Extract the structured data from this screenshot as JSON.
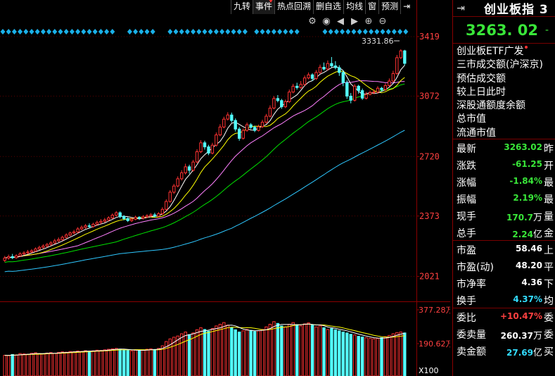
{
  "toolbar": {
    "items": [
      "九转",
      "事件",
      "热点回溯",
      "删自选",
      "均线",
      "窗",
      "预测"
    ],
    "close_glyph": "⇥"
  },
  "chart_data": {
    "type": "candlestick",
    "y_axis_ticks": [
      "3419",
      "3072",
      "2720",
      "2373",
      "2021"
    ],
    "y_tick_values": [
      3419,
      3072,
      2720,
      2373,
      2021
    ],
    "ylim": [
      1900,
      3460
    ],
    "high_marker": "3331.86",
    "volume_ticks": [
      "377.28万",
      "190.62万"
    ],
    "volume_unit": "X100",
    "candles": [
      [
        2115,
        2128,
        2140,
        2105
      ],
      [
        2128,
        2136,
        2148,
        2118
      ],
      [
        2136,
        2130,
        2152,
        2122
      ],
      [
        2130,
        2141,
        2150,
        2124
      ],
      [
        2141,
        2152,
        2162,
        2135
      ],
      [
        2152,
        2158,
        2168,
        2144
      ],
      [
        2158,
        2163,
        2175,
        2150
      ],
      [
        2163,
        2170,
        2180,
        2157
      ],
      [
        2170,
        2181,
        2190,
        2163
      ],
      [
        2181,
        2190,
        2200,
        2175
      ],
      [
        2190,
        2198,
        2208,
        2182
      ],
      [
        2198,
        2207,
        2216,
        2190
      ],
      [
        2207,
        2216,
        2226,
        2200
      ],
      [
        2216,
        2228,
        2240,
        2210
      ],
      [
        2228,
        2236,
        2248,
        2220
      ],
      [
        2236,
        2249,
        2258,
        2228
      ],
      [
        2249,
        2262,
        2272,
        2242
      ],
      [
        2262,
        2274,
        2282,
        2255
      ],
      [
        2274,
        2280,
        2292,
        2266
      ],
      [
        2280,
        2298,
        2308,
        2272
      ],
      [
        2298,
        2307,
        2318,
        2290
      ],
      [
        2307,
        2316,
        2326,
        2298
      ],
      [
        2316,
        2312,
        2330,
        2302
      ],
      [
        2312,
        2325,
        2334,
        2305
      ],
      [
        2325,
        2335,
        2346,
        2316
      ],
      [
        2335,
        2342,
        2355,
        2326
      ],
      [
        2342,
        2350,
        2362,
        2334
      ],
      [
        2350,
        2362,
        2372,
        2342
      ],
      [
        2362,
        2378,
        2388,
        2355
      ],
      [
        2378,
        2392,
        2402,
        2370
      ],
      [
        2392,
        2370,
        2400,
        2360
      ],
      [
        2370,
        2358,
        2378,
        2348
      ],
      [
        2358,
        2346,
        2366,
        2338
      ],
      [
        2346,
        2355,
        2364,
        2338
      ],
      [
        2355,
        2366,
        2375,
        2348
      ],
      [
        2366,
        2360,
        2372,
        2350
      ],
      [
        2360,
        2368,
        2378,
        2352
      ],
      [
        2368,
        2374,
        2384,
        2360
      ],
      [
        2374,
        2380,
        2390,
        2366
      ],
      [
        2380,
        2372,
        2392,
        2364
      ],
      [
        2372,
        2386,
        2396,
        2365
      ],
      [
        2386,
        2412,
        2424,
        2380
      ],
      [
        2412,
        2458,
        2470,
        2405
      ],
      [
        2458,
        2512,
        2524,
        2450
      ],
      [
        2512,
        2548,
        2560,
        2502
      ],
      [
        2548,
        2590,
        2604,
        2540
      ],
      [
        2590,
        2625,
        2640,
        2580
      ],
      [
        2625,
        2660,
        2678,
        2615
      ],
      [
        2660,
        2640,
        2672,
        2620
      ],
      [
        2640,
        2688,
        2700,
        2632
      ],
      [
        2688,
        2748,
        2762,
        2680
      ],
      [
        2748,
        2800,
        2815,
        2740
      ],
      [
        2800,
        2776,
        2812,
        2760
      ],
      [
        2776,
        2740,
        2788,
        2728
      ],
      [
        2740,
        2786,
        2800,
        2732
      ],
      [
        2786,
        2846,
        2860,
        2778
      ],
      [
        2846,
        2892,
        2908,
        2838
      ],
      [
        2892,
        2938,
        2952,
        2884
      ],
      [
        2938,
        2962,
        2978,
        2930
      ],
      [
        2962,
        2930,
        2976,
        2918
      ],
      [
        2930,
        2880,
        2942,
        2866
      ],
      [
        2880,
        2826,
        2892,
        2812
      ],
      [
        2826,
        2872,
        2884,
        2818
      ],
      [
        2872,
        2905,
        2918,
        2864
      ],
      [
        2905,
        2890,
        2915,
        2880
      ],
      [
        2890,
        2872,
        2900,
        2862
      ],
      [
        2872,
        2894,
        2906,
        2866
      ],
      [
        2894,
        2920,
        2934,
        2886
      ],
      [
        2920,
        2955,
        2968,
        2912
      ],
      [
        2955,
        3002,
        3018,
        2948
      ],
      [
        3002,
        3058,
        3072,
        2995
      ],
      [
        3058,
        3046,
        3078,
        3036
      ],
      [
        3046,
        3010,
        3056,
        2998
      ],
      [
        3010,
        3040,
        3052,
        3002
      ],
      [
        3040,
        3096,
        3110,
        3032
      ],
      [
        3096,
        3130,
        3144,
        3088
      ],
      [
        3130,
        3122,
        3150,
        3110
      ],
      [
        3122,
        3140,
        3160,
        3114
      ],
      [
        3140,
        3178,
        3192,
        3132
      ],
      [
        3178,
        3196,
        3210,
        3170
      ],
      [
        3196,
        3175,
        3205,
        3160
      ],
      [
        3175,
        3210,
        3224,
        3166
      ],
      [
        3210,
        3240,
        3256,
        3202
      ],
      [
        3240,
        3230,
        3268,
        3222
      ],
      [
        3230,
        3262,
        3280,
        3220
      ],
      [
        3262,
        3248,
        3300,
        3240
      ],
      [
        3248,
        3238,
        3276,
        3228
      ],
      [
        3238,
        3210,
        3252,
        3190
      ],
      [
        3210,
        3150,
        3222,
        3130
      ],
      [
        3150,
        3072,
        3164,
        3056
      ],
      [
        3072,
        3048,
        3090,
        3030
      ],
      [
        3048,
        3130,
        3142,
        3040
      ],
      [
        3130,
        3104,
        3138,
        3086
      ],
      [
        3104,
        3060,
        3116,
        3050
      ],
      [
        3060,
        3082,
        3096,
        3052
      ],
      [
        3082,
        3092,
        3104,
        3076
      ],
      [
        3092,
        3096,
        3110,
        3084
      ],
      [
        3096,
        3118,
        3130,
        3088
      ],
      [
        3118,
        3110,
        3126,
        3100
      ],
      [
        3110,
        3134,
        3146,
        3102
      ],
      [
        3134,
        3160,
        3175,
        3126
      ],
      [
        3160,
        3204,
        3220,
        3152
      ],
      [
        3204,
        3296,
        3312,
        3196
      ],
      [
        3296,
        3336,
        3345,
        3288
      ],
      [
        3336,
        3263,
        3342,
        3250
      ]
    ],
    "volumes": [
      120,
      118,
      125,
      122,
      130,
      128,
      126,
      132,
      135,
      130,
      128,
      133,
      136,
      131,
      137,
      140,
      138,
      142,
      141,
      145,
      143,
      147,
      144,
      146,
      150,
      148,
      152,
      155,
      158,
      160,
      156,
      150,
      148,
      146,
      152,
      150,
      149,
      155,
      158,
      154,
      160,
      175,
      200,
      215,
      225,
      232,
      245,
      255,
      240,
      250,
      268,
      280,
      270,
      260,
      275,
      290,
      300,
      310,
      295,
      280,
      268,
      255,
      262,
      270,
      265,
      258,
      262,
      270,
      285,
      300,
      315,
      305,
      290,
      285,
      300,
      310,
      298,
      290,
      302,
      308,
      295,
      285,
      290,
      280,
      270,
      275,
      268,
      262,
      255,
      250,
      242,
      238,
      230,
      226,
      222,
      218,
      215,
      218,
      222,
      228,
      235,
      245,
      252,
      255,
      250
    ]
  },
  "right_panel": {
    "header_icon": "⇥",
    "title": "创业板指 3",
    "price": "3263. 02",
    "change_fragment": "-",
    "info_rows": [
      "创业板ETF广发",
      "三市成交额(沪深京)",
      "预估成交额",
      "较上日此时",
      "深股通额度余额",
      "总市值",
      "流通市值"
    ],
    "quote_rows": [
      {
        "label": "最新",
        "value": "3263.02",
        "unit": "",
        "suffix": "昨",
        "color": "green",
        "group": 1
      },
      {
        "label": "涨跌",
        "value": "-61.25",
        "unit": "",
        "suffix": "开",
        "color": "green",
        "group": 1
      },
      {
        "label": "涨幅",
        "value": "-1.84%",
        "unit": "",
        "suffix": "最",
        "color": "green",
        "group": 1
      },
      {
        "label": "振幅",
        "value": "2.19%",
        "unit": "",
        "suffix": "最",
        "color": "green",
        "group": 1
      },
      {
        "label": "现手",
        "value": "170.7",
        "unit": "万",
        "suffix": "量",
        "color": "green",
        "group": 1
      },
      {
        "label": "总手",
        "value": "2.24",
        "unit": "亿",
        "suffix": "金",
        "color": "green",
        "group": 1
      },
      {
        "label": "市盈",
        "value": "58.46",
        "unit": "",
        "suffix": "上",
        "color": "white",
        "group": 2
      },
      {
        "label": "市盈(动)",
        "value": "48.20",
        "unit": "",
        "suffix": "平",
        "color": "white",
        "group": 2
      },
      {
        "label": "市净率",
        "value": "4.36",
        "unit": "",
        "suffix": "下",
        "color": "white",
        "group": 2
      },
      {
        "label": "换手",
        "value": "4.37%",
        "unit": "",
        "suffix": "均",
        "color": "cyan",
        "group": 2
      },
      {
        "label": "委比",
        "value": "+10.47%",
        "unit": "",
        "suffix": "委",
        "color": "red",
        "group": 3
      },
      {
        "label": "委卖量",
        "value": "260.37",
        "unit": "万",
        "suffix": "委",
        "color": "white",
        "group": 3
      },
      {
        "label": "卖金额",
        "value": "27.69",
        "unit": "亿",
        "suffix": "买",
        "color": "cyan",
        "group": 3
      }
    ]
  },
  "colors": {
    "up": "#ff3232",
    "down": "#54ffff",
    "ma5": "#ffffff",
    "ma10": "#ffff00",
    "ma20": "#ff80ff",
    "ma30": "#00e000",
    "ma60": "#2ec7ff",
    "axis_border": "#8b0000"
  }
}
